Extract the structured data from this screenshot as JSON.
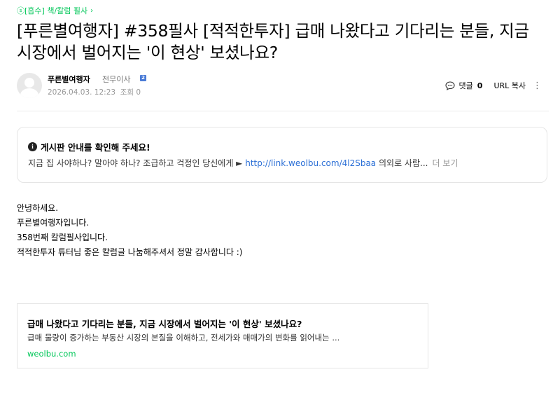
{
  "breadcrumb": {
    "label": "ⓢ[흡수] 책/칼럼 필사",
    "chevron": "›"
  },
  "post": {
    "title": "[푸른별여행자] #358필사 [적적한투자] 급매 나왔다고 기다리는 분들, 지금 시장에서 벌어지는 '이 현상' 보셨나요?",
    "author": {
      "name": "푸른별여행자",
      "rank": "전무이사",
      "rank_badge": "2"
    },
    "date": "2026.04.03. 12:23",
    "views_label": "조회 0"
  },
  "tools": {
    "comment_label": "댓글",
    "comment_count": "0",
    "url_copy": "URL 복사",
    "more": "⋮"
  },
  "notice": {
    "title": "게시판 안내를 확인해 주세요!",
    "icon": "info-icon",
    "text_before": "지금 집 사야하나? 말아야 하나? 조급하고 걱정인 당신에게 ► ",
    "link": "http://link.weolbu.com/4l2Sbaa",
    "text_after": " 의외로 사람...",
    "more": "더 보기"
  },
  "content": {
    "lines": [
      "안녕하세요.",
      "푸른별여행자입니다.",
      "358번째 칼럼필사입니다.",
      "적적한투자 튜터님 좋은 칼럼글 나눔해주셔서 정말 감사합니다 :)"
    ]
  },
  "link_card": {
    "title": "급매 나왔다고 기다리는 분들, 지금 시장에서 벌어지는 '이 현상' 보셨나요?",
    "description": "급매 물량이 증가하는 부동산 시장의 본질을 이해하고, 전세가와 매매가의 변화를 읽어내는 ...",
    "domain": "weolbu.com"
  },
  "colors": {
    "accent": "#03c75a",
    "link": "#2b6fd6",
    "badge": "#4a7bd6"
  }
}
